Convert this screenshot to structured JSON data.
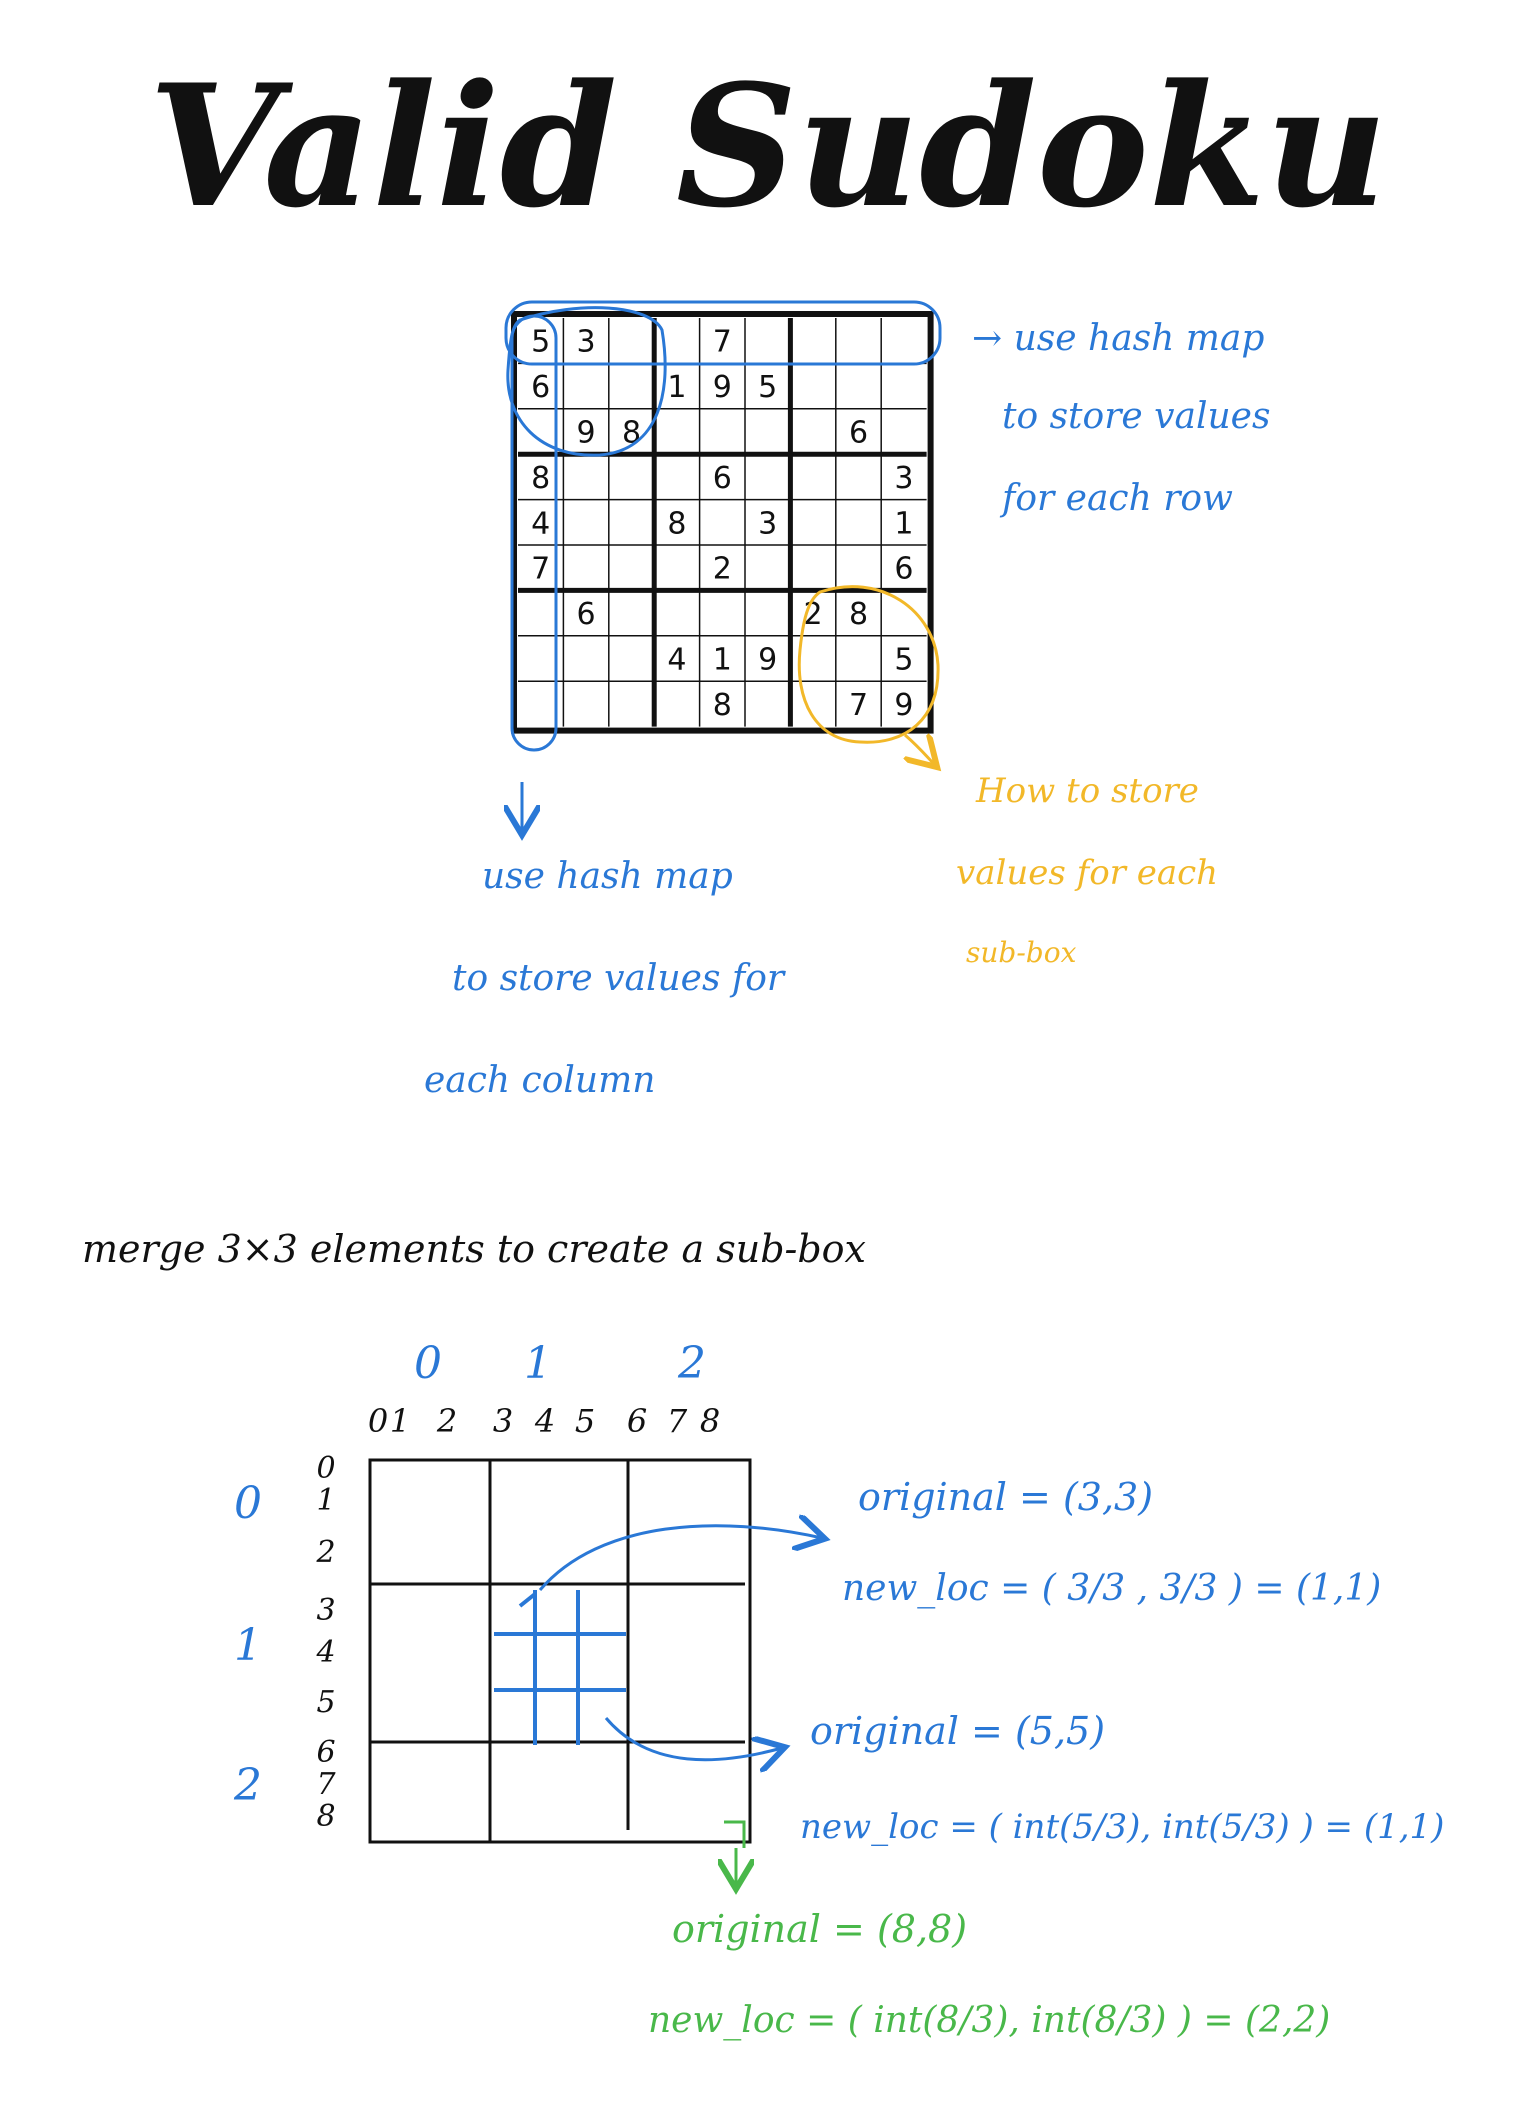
{
  "title": "Valid Sudoku",
  "colors": {
    "ink": "#111111",
    "blue": "#2a78d6",
    "yellow": "#f2b829",
    "green": "#49b84a"
  },
  "sudoku": {
    "rows": [
      [
        "5",
        "3",
        "",
        "",
        "7",
        "",
        "",
        "",
        ""
      ],
      [
        "6",
        "",
        "",
        "1",
        "9",
        "5",
        "",
        "",
        ""
      ],
      [
        "",
        "9",
        "8",
        "",
        "",
        "",
        "",
        "6",
        ""
      ],
      [
        "8",
        "",
        "",
        "",
        "6",
        "",
        "",
        "",
        "3"
      ],
      [
        "4",
        "",
        "",
        "8",
        "",
        "3",
        "",
        "",
        "1"
      ],
      [
        "7",
        "",
        "",
        "",
        "2",
        "",
        "",
        "",
        "6"
      ],
      [
        "",
        "6",
        "",
        "",
        "",
        "",
        "2",
        "8",
        ""
      ],
      [
        "",
        "",
        "",
        "4",
        "1",
        "9",
        "",
        "",
        "5"
      ],
      [
        "",
        "",
        "",
        "",
        "8",
        "",
        "",
        "7",
        "9"
      ]
    ]
  },
  "notes": {
    "row": [
      "→ use hash map",
      "to store values",
      "for each row"
    ],
    "column": [
      "use hash map",
      "to store values for",
      "each column"
    ],
    "subbox": [
      "How to store",
      "values for each",
      "sub-box"
    ],
    "merge": "merge 3×3 elements to create a sub-box"
  },
  "grid": {
    "box_labels": [
      "0",
      "1",
      "2"
    ],
    "index_labels": [
      "0",
      "1",
      "2",
      "3",
      "4",
      "5",
      "6",
      "7",
      "8"
    ]
  },
  "examples": [
    {
      "original": "original = (3,3)",
      "new_loc": "new_loc = ( 3/3 , 3/3 ) = (1,1)"
    },
    {
      "original": "original = (5,5)",
      "new_loc": "new_loc = ( int(5/3), int(5/3) ) = (1,1)"
    },
    {
      "original": "original = (8,8)",
      "new_loc": "new_loc = ( int(8/3), int(8/3) ) = (2,2)"
    }
  ]
}
